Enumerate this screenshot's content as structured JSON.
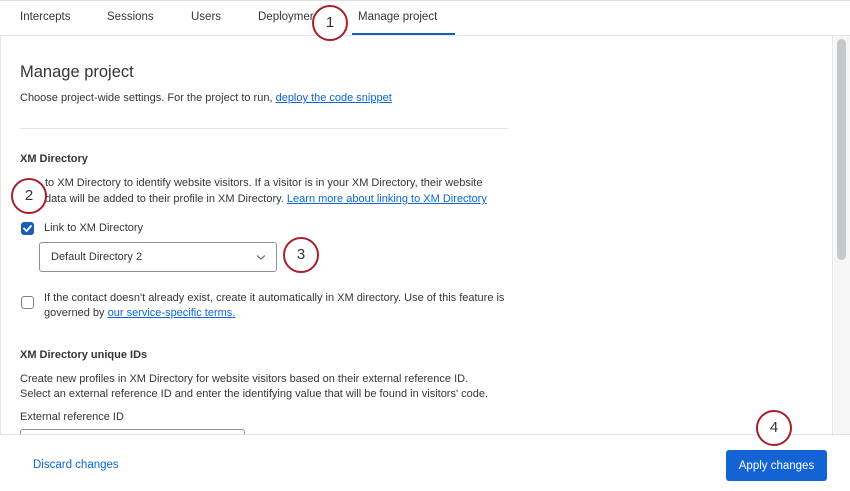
{
  "tabs": [
    {
      "label": "Intercepts"
    },
    {
      "label": "Sessions"
    },
    {
      "label": "Users"
    },
    {
      "label": "Deploymer"
    },
    {
      "label": "Manage project"
    }
  ],
  "page": {
    "title": "Manage project",
    "description_prefix": "Choose project-wide settings. For the project to run, ",
    "description_link": "deploy the code snippet"
  },
  "xm_directory": {
    "heading": "XM Directory",
    "line1": "to XM Directory to identify website visitors. If a visitor is in your XM Directory, their website",
    "line2_prefix": "data will be added to their profile in XM Directory. ",
    "line2_link": "Learn more about linking to XM Directory",
    "link_checkbox_label": "Link to XM Directory",
    "link_checkbox_checked": true,
    "directory_select_value": "Default Directory 2",
    "auto_create_line1": "If the contact doesn't already exist, create it automatically in XM directory. Use of this feature is",
    "auto_create_line2_prefix": "governed by ",
    "auto_create_link": "our service-specific terms.",
    "auto_create_checked": false
  },
  "unique_ids": {
    "heading": "XM Directory unique IDs",
    "line1": "Create new profiles in XM Directory for website visitors based on their external reference ID.",
    "line2": "Select an external reference ID and enter the identifying value that will be found in visitors' code.",
    "external_ref_label": "External reference ID"
  },
  "footer": {
    "discard_label": "Discard changes",
    "apply_label": "Apply changes"
  },
  "callouts": [
    "1",
    "2",
    "3",
    "4"
  ],
  "colors": {
    "accent": "#1463d4",
    "link": "#0b66d6",
    "callout_border": "#a81f2a"
  }
}
